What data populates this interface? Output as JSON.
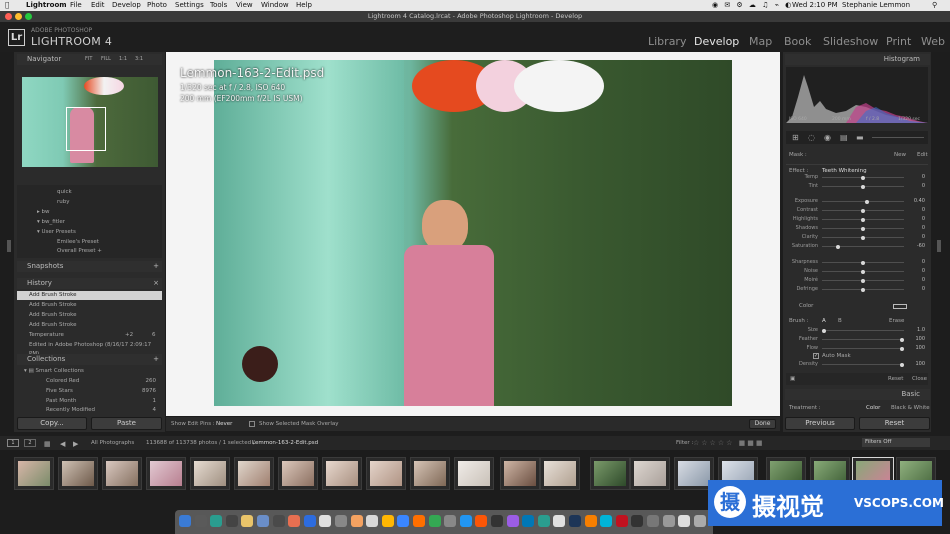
{
  "mac_menu": {
    "app": "Lightroom",
    "items": [
      "File",
      "Edit",
      "Develop",
      "Photo",
      "Settings",
      "Tools",
      "View",
      "Window",
      "Help"
    ],
    "status_time": "Wed 2:10 PM",
    "user": "Stephanie Lemmon"
  },
  "window_title": "Lightroom 4 Catalog.lrcat - Adobe Photoshop Lightroom - Develop",
  "identity": {
    "logo": "Lr",
    "adobe": "ADOBE PHOTOSHOP",
    "product": "LIGHTROOM 4"
  },
  "modules": [
    "Library",
    "Develop",
    "Map",
    "Book",
    "Slideshow",
    "Print",
    "Web"
  ],
  "active_module": "Develop",
  "left_panel": {
    "navigator": "Navigator",
    "nav_zoom": [
      "FIT",
      "FILL",
      "1:1",
      "3:1"
    ],
    "presets": [
      "quick",
      "ruby",
      "bw",
      "bw_fitler",
      "User Presets",
      "Emilee's Preset",
      "Overall Preset +"
    ],
    "snapshots": "Snapshots",
    "history": "History",
    "history_items": [
      "Add Brush Stroke",
      "Add Brush Stroke",
      "Add Brush Stroke",
      "Add Brush Stroke",
      "Add Brush Stroke",
      "Temperature",
      "Edited in Adobe Photoshop (8/16/17 2:09:17 PM)"
    ],
    "history_values": [
      "",
      "",
      "",
      "",
      "",
      "+2",
      "6"
    ],
    "collections": "Collections",
    "collection_items": [
      {
        "label": "Smart Collections",
        "count": ""
      },
      {
        "label": "Colored Red",
        "count": "260"
      },
      {
        "label": "Five Stars",
        "count": "8976"
      },
      {
        "label": "Past Month",
        "count": "1"
      },
      {
        "label": "Recently Modified",
        "count": "4"
      }
    ],
    "copy": "Copy...",
    "paste": "Paste"
  },
  "photo": {
    "filename": "Lemmon-163-2-Edit.psd",
    "exposure": "1/320 sec at f / 2.8, ISO 640",
    "lens": "200 mm (EF200mm f/2L IS USM)"
  },
  "toolbar": {
    "edit_pins_label": "Show Edit Pins :",
    "edit_pins_value": "Never",
    "mask_overlay": "Show Selected Mask Overlay",
    "done": "Done"
  },
  "right_panel": {
    "histogram": "Histogram",
    "hist_info": [
      "ISO 640",
      "200 mm",
      "f / 2.8",
      "1/320 sec"
    ],
    "mask_label": "Mask :",
    "mask_new": "New",
    "mask_edit": "Edit",
    "effect_label": "Effect :",
    "effect_value": "Teeth Whitening",
    "sliders": [
      {
        "label": "Temp",
        "value": "0",
        "pos": 0.5
      },
      {
        "label": "Tint",
        "value": "0",
        "pos": 0.5
      },
      {
        "label": "Exposure",
        "value": "0.40",
        "pos": 0.55
      },
      {
        "label": "Contrast",
        "value": "0",
        "pos": 0.5
      },
      {
        "label": "Highlights",
        "value": "0",
        "pos": 0.5
      },
      {
        "label": "Shadows",
        "value": "0",
        "pos": 0.5
      },
      {
        "label": "Clarity",
        "value": "0",
        "pos": 0.5
      },
      {
        "label": "Saturation",
        "value": "-60",
        "pos": 0.2
      },
      {
        "label": "Sharpness",
        "value": "0",
        "pos": 0.5
      },
      {
        "label": "Noise",
        "value": "0",
        "pos": 0.5
      },
      {
        "label": "Moiré",
        "value": "0",
        "pos": 0.5
      },
      {
        "label": "Defringe",
        "value": "0",
        "pos": 0.5
      }
    ],
    "color_label": "Color",
    "brush_label": "Brush :",
    "brush_a": "A",
    "brush_b": "B",
    "brush_erase": "Erase",
    "brush_sliders": [
      {
        "label": "Size",
        "value": "1.0",
        "pos": 0.02
      },
      {
        "label": "Feather",
        "value": "100",
        "pos": 0.98
      },
      {
        "label": "Flow",
        "value": "100",
        "pos": 0.98
      },
      {
        "label": "Density",
        "value": "100",
        "pos": 0.98
      }
    ],
    "auto_mask": "Auto Mask",
    "reset": "Reset",
    "close": "Close",
    "basic": "Basic",
    "treatment": "Treatment :",
    "treat_color": "Color",
    "treat_bw": "Black & White",
    "previous": "Previous",
    "reset_btn": "Reset"
  },
  "filmstrip_bar": {
    "pages": [
      "1",
      "2"
    ],
    "source": "All Photographs",
    "count": "113688 of 113738 photos / 1 selected /",
    "current_file": "Lemmon-163-2-Edit.psd",
    "filter_label": "Filter :",
    "filter_value": "Filters Off"
  },
  "watermark": {
    "cn": "摄视觉",
    "url": "VSCOPS.COM",
    "logo_char": "摄"
  },
  "colors": {
    "accent": "#2b6fd6",
    "background": "#1d1d1d",
    "panel": "#2b2b2b",
    "selected": "#d2d2d2"
  }
}
